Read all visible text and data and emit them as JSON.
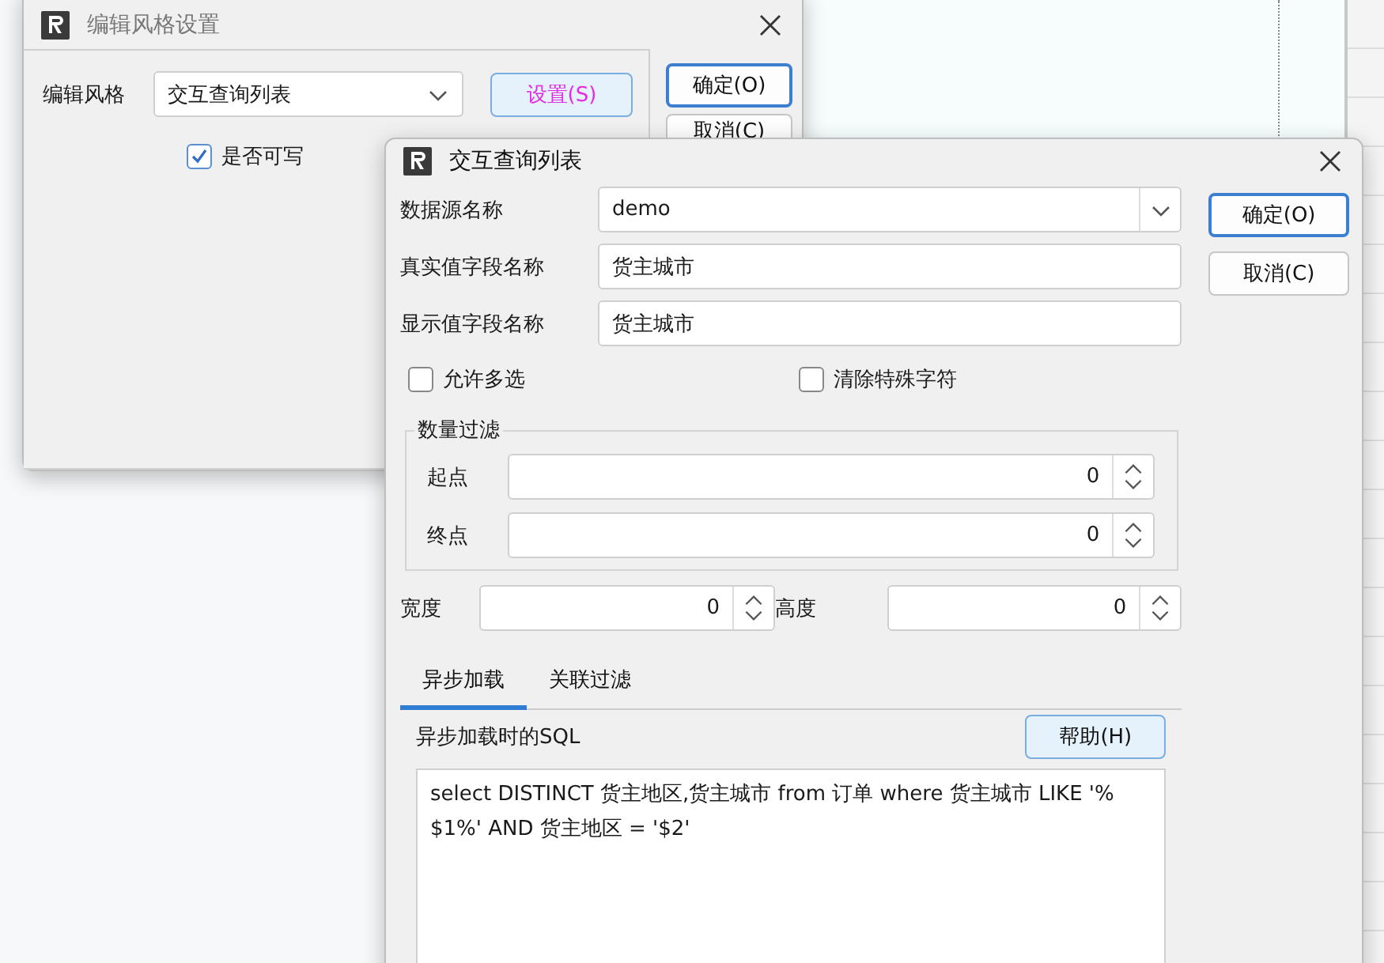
{
  "back_window": {
    "title": "编辑风格设置",
    "style_label": "编辑风格",
    "style_value": "交互查询列表",
    "setup_button": "设置(S)",
    "writable": {
      "label": "是否可写",
      "checked": true
    },
    "buttons": [
      {
        "label": "确定(O)",
        "default": true
      },
      {
        "label": "取消(C)",
        "default": false
      }
    ]
  },
  "front_window": {
    "title": "交互查询列表",
    "fields": [
      {
        "kind": "combo",
        "label": "数据源名称",
        "value": "demo"
      },
      {
        "kind": "text",
        "label": "真实值字段名称",
        "value": "货主城市"
      },
      {
        "kind": "text",
        "label": "显示值字段名称",
        "value": "货主城市"
      }
    ],
    "buttons": [
      {
        "label": "确定(O)",
        "default": true
      },
      {
        "label": "取消(C)",
        "default": false
      }
    ],
    "checkboxes": [
      {
        "label": "允许多选",
        "checked": false
      },
      {
        "label": "清除特殊字符",
        "checked": false
      }
    ],
    "quantity_filter": {
      "title": "数量过滤",
      "rows": [
        {
          "label": "起点",
          "value": "0"
        },
        {
          "label": "终点",
          "value": "0"
        }
      ]
    },
    "size_fields": [
      {
        "label": "宽度",
        "value": "0"
      },
      {
        "label": "高度",
        "value": "0"
      }
    ],
    "tabs": [
      {
        "label": "异步加载",
        "selected": true
      },
      {
        "label": "关联过滤",
        "selected": false
      }
    ],
    "sql_label": "异步加载时的SQL",
    "help_button": "帮助(H)",
    "sql": "select  DISTINCT 货主地区,货主城市 from 订单 where 货主城市 LIKE '%$1%' AND 货主地区 = '$2'"
  }
}
